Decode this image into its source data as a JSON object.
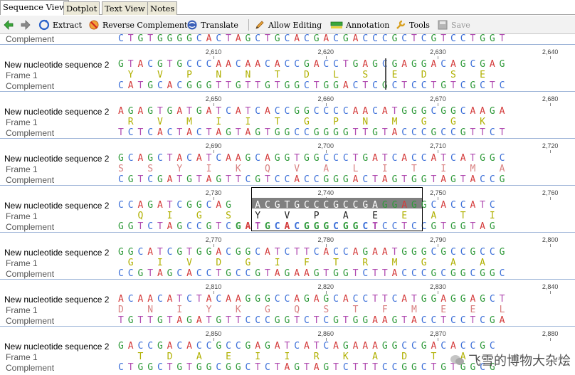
{
  "tabs": [
    "Sequence View",
    "Dotplot",
    "Text View",
    "Notes"
  ],
  "toolbar": {
    "extract": "Extract",
    "reverse_complement": "Reverse Complement",
    "translate": "Translate",
    "allow_editing": "Allow Editing",
    "annotation": "Annotation",
    "tools": "Tools",
    "save": "Save"
  },
  "labels": {
    "sequence": "New nucleotide sequence 2",
    "frame": "Frame 1",
    "complement": "Complement"
  },
  "top_complement": "CTGTGGGGCACTAGCTGCACGACGACCCGCTCGTCCTGGT",
  "blocks": [
    {
      "ticks": [
        "2,610",
        "2,620",
        "2,630",
        "2,640"
      ],
      "seq": "GTACGTGCCCAACAACACCGACCTGAGCGAGGACAGCGAG",
      "aa": " Y  V  P  N  N  T  D  L  S  E  D  S  E ",
      "comp": "CATGCACGGGTTGTTGTGGCTGGACTCGCTCCTGTCGCTC"
    },
    {
      "ticks": [
        "2,650",
        "2,660",
        "2,670",
        "2,680"
      ],
      "seq": "AGAGTGATGATCATCACCGGCCCCAACATGGGCGGCAAGA",
      "aa": " R  V  M  I  I  T  G  P  N  M  G  G  K ",
      "comp": "TCTCACTACTAGTAGTGGCCGGGGTTGTACCCGCCGTTCT"
    },
    {
      "ticks": [
        "2,690",
        "2,700",
        "2,710",
        "2,720"
      ],
      "seq": "GCAGCTACATCAAGCAGGTGGCCCTGATCACCATCATGGC",
      "aa": "S  S  Y  I  K  Q  V  A  L  I  T  I  M  A",
      "comp": "CGTCGATGTAGTTCGTCCACCGGGACTAGTGGTAGTACCG"
    },
    {
      "ticks": [
        "2,730",
        "2,740",
        "2,750",
        "2,760"
      ],
      "seq": "CCAGATCGGCAGCTACGTGCCCGCCGAGGAGGCACCATC",
      "aa": "  Q  I  G  S  Y  V  P  A  E  E  A  T  I",
      "comp": "GGTCTAGCCGTCGATGCACGGGCGGCTCCTCCGTGGTAG"
    },
    {
      "ticks": [
        "2,770",
        "2,780",
        "2,790",
        "2,800"
      ],
      "seq": "GGCATCGTGGACGGCATCTTCACCAGAATGGGCGCCGCCG",
      "aa": " G  I  V  D  G  I  F  T  R  M  G  A  A ",
      "comp": "CCGTAGCACCTGCCGTAGAAGTGGTCTTACCCGCGGCGGC"
    },
    {
      "ticks": [
        "2,810",
        "2,820",
        "2,830",
        "2,840"
      ],
      "seq": "ACAACATCTACAAGGGCCAGAGCACCTTCATGGAGGAGCT",
      "aa": "D  N  I  Y  K  G  Q  S  T  F  M  E  E  L",
      "comp": "TGTTGTAGATGTTCCCGGTCTCGTGGAAGTACCTCCTCGA"
    },
    {
      "ticks": [
        "2,850",
        "2,860",
        "2,870",
        "2,880"
      ],
      "seq": "GACCGACACCGCCGAGATCATCAGAAAGGCCGACACCGC",
      "aa": "  T  D  A  E  I  I  R  K  A  D  T  A   ",
      "comp": "CTGGCTGTGGCGGCTCTAGTAGTCTTTCCGGCTGTGGCG"
    }
  ],
  "selection": {
    "ticks": [
      "2,740",
      "2,750"
    ]
  },
  "watermark": "飞雪的博物大杂烩",
  "colors": {
    "A": "#d43c3c",
    "C": "#3c6fd8",
    "G": "#2f9a3a",
    "T": "#b04ab0",
    "frame_aa": "#b0b000",
    "selection_header": "#808080",
    "block_divider": "#9db4d8"
  }
}
